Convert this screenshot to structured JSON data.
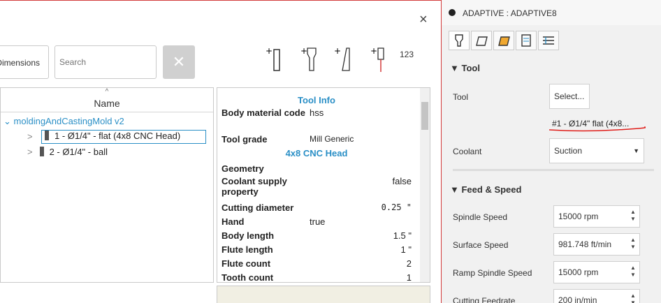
{
  "dialog": {
    "close_glyph": "×",
    "dimensions_label": "Dimensions",
    "search_placeholder": "Search",
    "clear_glyph": "✕",
    "toolbar_count_label": "123"
  },
  "tree": {
    "header": "Name",
    "sort_caret": "^",
    "root_label": "moldingAndCastingMold v2",
    "items": [
      {
        "label": "1 - Ø1/4\" - flat (4x8 CNC Head)"
      },
      {
        "label": "2 - Ø1/4\" - ball"
      }
    ]
  },
  "tool_info": {
    "title": "Tool Info",
    "body_material_label": "Body material code",
    "body_material_value": "hss",
    "tool_grade_label": "Tool grade",
    "tool_grade_value": "Mill Generic",
    "holder_title": "4x8 CNC Head",
    "geometry_label": "Geometry",
    "coolant_supply_label": "Coolant supply property",
    "coolant_supply_value": "false",
    "cutting_diameter_label": "Cutting diameter",
    "cutting_diameter_value": "0.25 \"",
    "hand_label": "Hand",
    "hand_value": "true",
    "body_length_label": "Body length",
    "body_length_value": "1.5 \"",
    "flute_length_label": "Flute length",
    "flute_length_value": "1 \"",
    "flute_count_label": "Flute count",
    "flute_count_value": "2",
    "tooth_count_label": "Tooth count",
    "tooth_count_value": "1"
  },
  "panel": {
    "title": "ADAPTIVE : ADAPTIVE8",
    "tool_section": "Tool",
    "tool_label": "Tool",
    "select_button": "Select...",
    "selected_tool": "#1 - Ø1/4\" flat (4x8...",
    "coolant_label": "Coolant",
    "coolant_value": "Suction",
    "feed_section": "Feed & Speed",
    "spindle_label": "Spindle Speed",
    "spindle_value": "15000 rpm",
    "surface_label": "Surface Speed",
    "surface_value": "981.748 ft/min",
    "ramp_label": "Ramp Spindle Speed",
    "ramp_value": "15000 rpm",
    "cutting_label": "Cutting Feedrate",
    "cutting_value": "200 in/min"
  },
  "colors": {
    "accent": "#2a8fc6",
    "underline": "#e0201c",
    "border": "#d23a3a"
  }
}
